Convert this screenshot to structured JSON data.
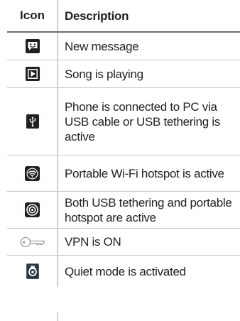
{
  "table": {
    "header": {
      "icon": "Icon",
      "description": "Description"
    },
    "rows": [
      {
        "icon": "new-message-icon",
        "description": "New message"
      },
      {
        "icon": "song-playing-icon",
        "description": "Song is playing"
      },
      {
        "icon": "usb-connected-icon",
        "description": "Phone is connected to PC via USB cable or USB tethering is active"
      },
      {
        "icon": "wifi-hotspot-icon",
        "description": "Portable Wi-Fi hotspot is active"
      },
      {
        "icon": "usb-and-hotspot-icon",
        "description": "Both USB tethering and portable hotspot are active"
      },
      {
        "icon": "vpn-key-icon",
        "description": "VPN is ON"
      },
      {
        "icon": "quiet-mode-icon",
        "description": "Quiet mode is activated"
      }
    ]
  },
  "colors": {
    "icon_background": "#231f20",
    "icon_foreground": "#ffffff",
    "vpn_icon_stroke": "#9a9a9a",
    "quiet_icon_background": "#4a5a66"
  }
}
